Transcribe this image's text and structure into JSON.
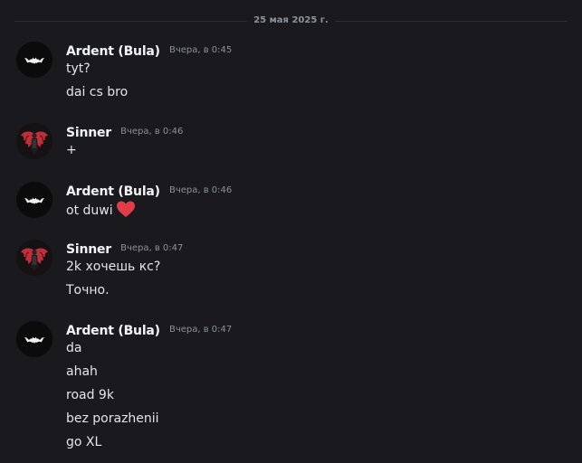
{
  "date_divider": "25 мая 2025 г.",
  "messages": [
    {
      "author": "Ardent (Bula)",
      "timestamp": "Вчера, в 0:45",
      "avatar_icon": "bat-logo-icon",
      "lines": [
        "tyt?",
        "dai cs bro"
      ]
    },
    {
      "author": "Sinner",
      "timestamp": "Вчера, в 0:46",
      "avatar_icon": "winged-figure-icon",
      "lines": [
        "+"
      ]
    },
    {
      "author": "Ardent (Bula)",
      "timestamp": "Вчера, в 0:46",
      "avatar_icon": "bat-logo-icon",
      "lines": [
        "ot duwi"
      ],
      "emoji": "heart-emoji-icon",
      "emoji_color": "#e23c48"
    },
    {
      "author": "Sinner",
      "timestamp": "Вчера, в 0:47",
      "avatar_icon": "winged-figure-icon",
      "lines": [
        "2k хочешь кс?",
        "Точно."
      ]
    },
    {
      "author": "Ardent (Bula)",
      "timestamp": "Вчера, в 0:47",
      "avatar_icon": "bat-logo-icon",
      "lines": [
        "da",
        "ahah",
        "road 9k",
        "bez porazhenii",
        "go XL"
      ]
    }
  ],
  "colors": {
    "background": "#1a1a1e",
    "username": "#f2f3f5",
    "timestamp": "#8d9098",
    "text": "#e4e5e8",
    "heart": "#e23c48",
    "sinner_avatar_accent": "#c0303a"
  }
}
